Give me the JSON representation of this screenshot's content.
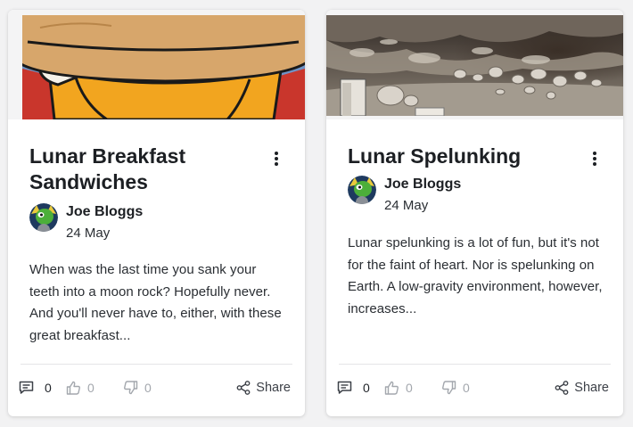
{
  "cards": [
    {
      "hero_image": "cartoon-breakfast-sandwich",
      "title": "Lunar Breakfast Sandwiches",
      "author": {
        "name": "Joe Bloggs",
        "avatar": "green-alien-avatar"
      },
      "date": "24 May",
      "excerpt": "When was the last time you sank your teeth into a moon rock? Hopefully never. And you'll never have to, either, with these great breakfast...",
      "comments": "0",
      "likes": "0",
      "dislikes": "0",
      "share_label": "Share"
    },
    {
      "hero_image": "lunar-cave-photo",
      "title": "Lunar Spelunking",
      "author": {
        "name": "Joe Bloggs",
        "avatar": "green-alien-avatar"
      },
      "date": "24 May",
      "excerpt": "Lunar spelunking is a lot of fun, but it's not for the faint of heart. Nor is spelunking on Earth. A low-gravity environment, however, increases...",
      "comments": "0",
      "likes": "0",
      "dislikes": "0",
      "share_label": "Share"
    }
  ],
  "colors": {
    "background": "#f2f2f3",
    "card": "#ffffff",
    "text": "#1c1f23",
    "muted": "#a3a7ad",
    "bun": "#d7a66b",
    "cheese": "#f2a51f",
    "sky": "#6f93c6"
  }
}
